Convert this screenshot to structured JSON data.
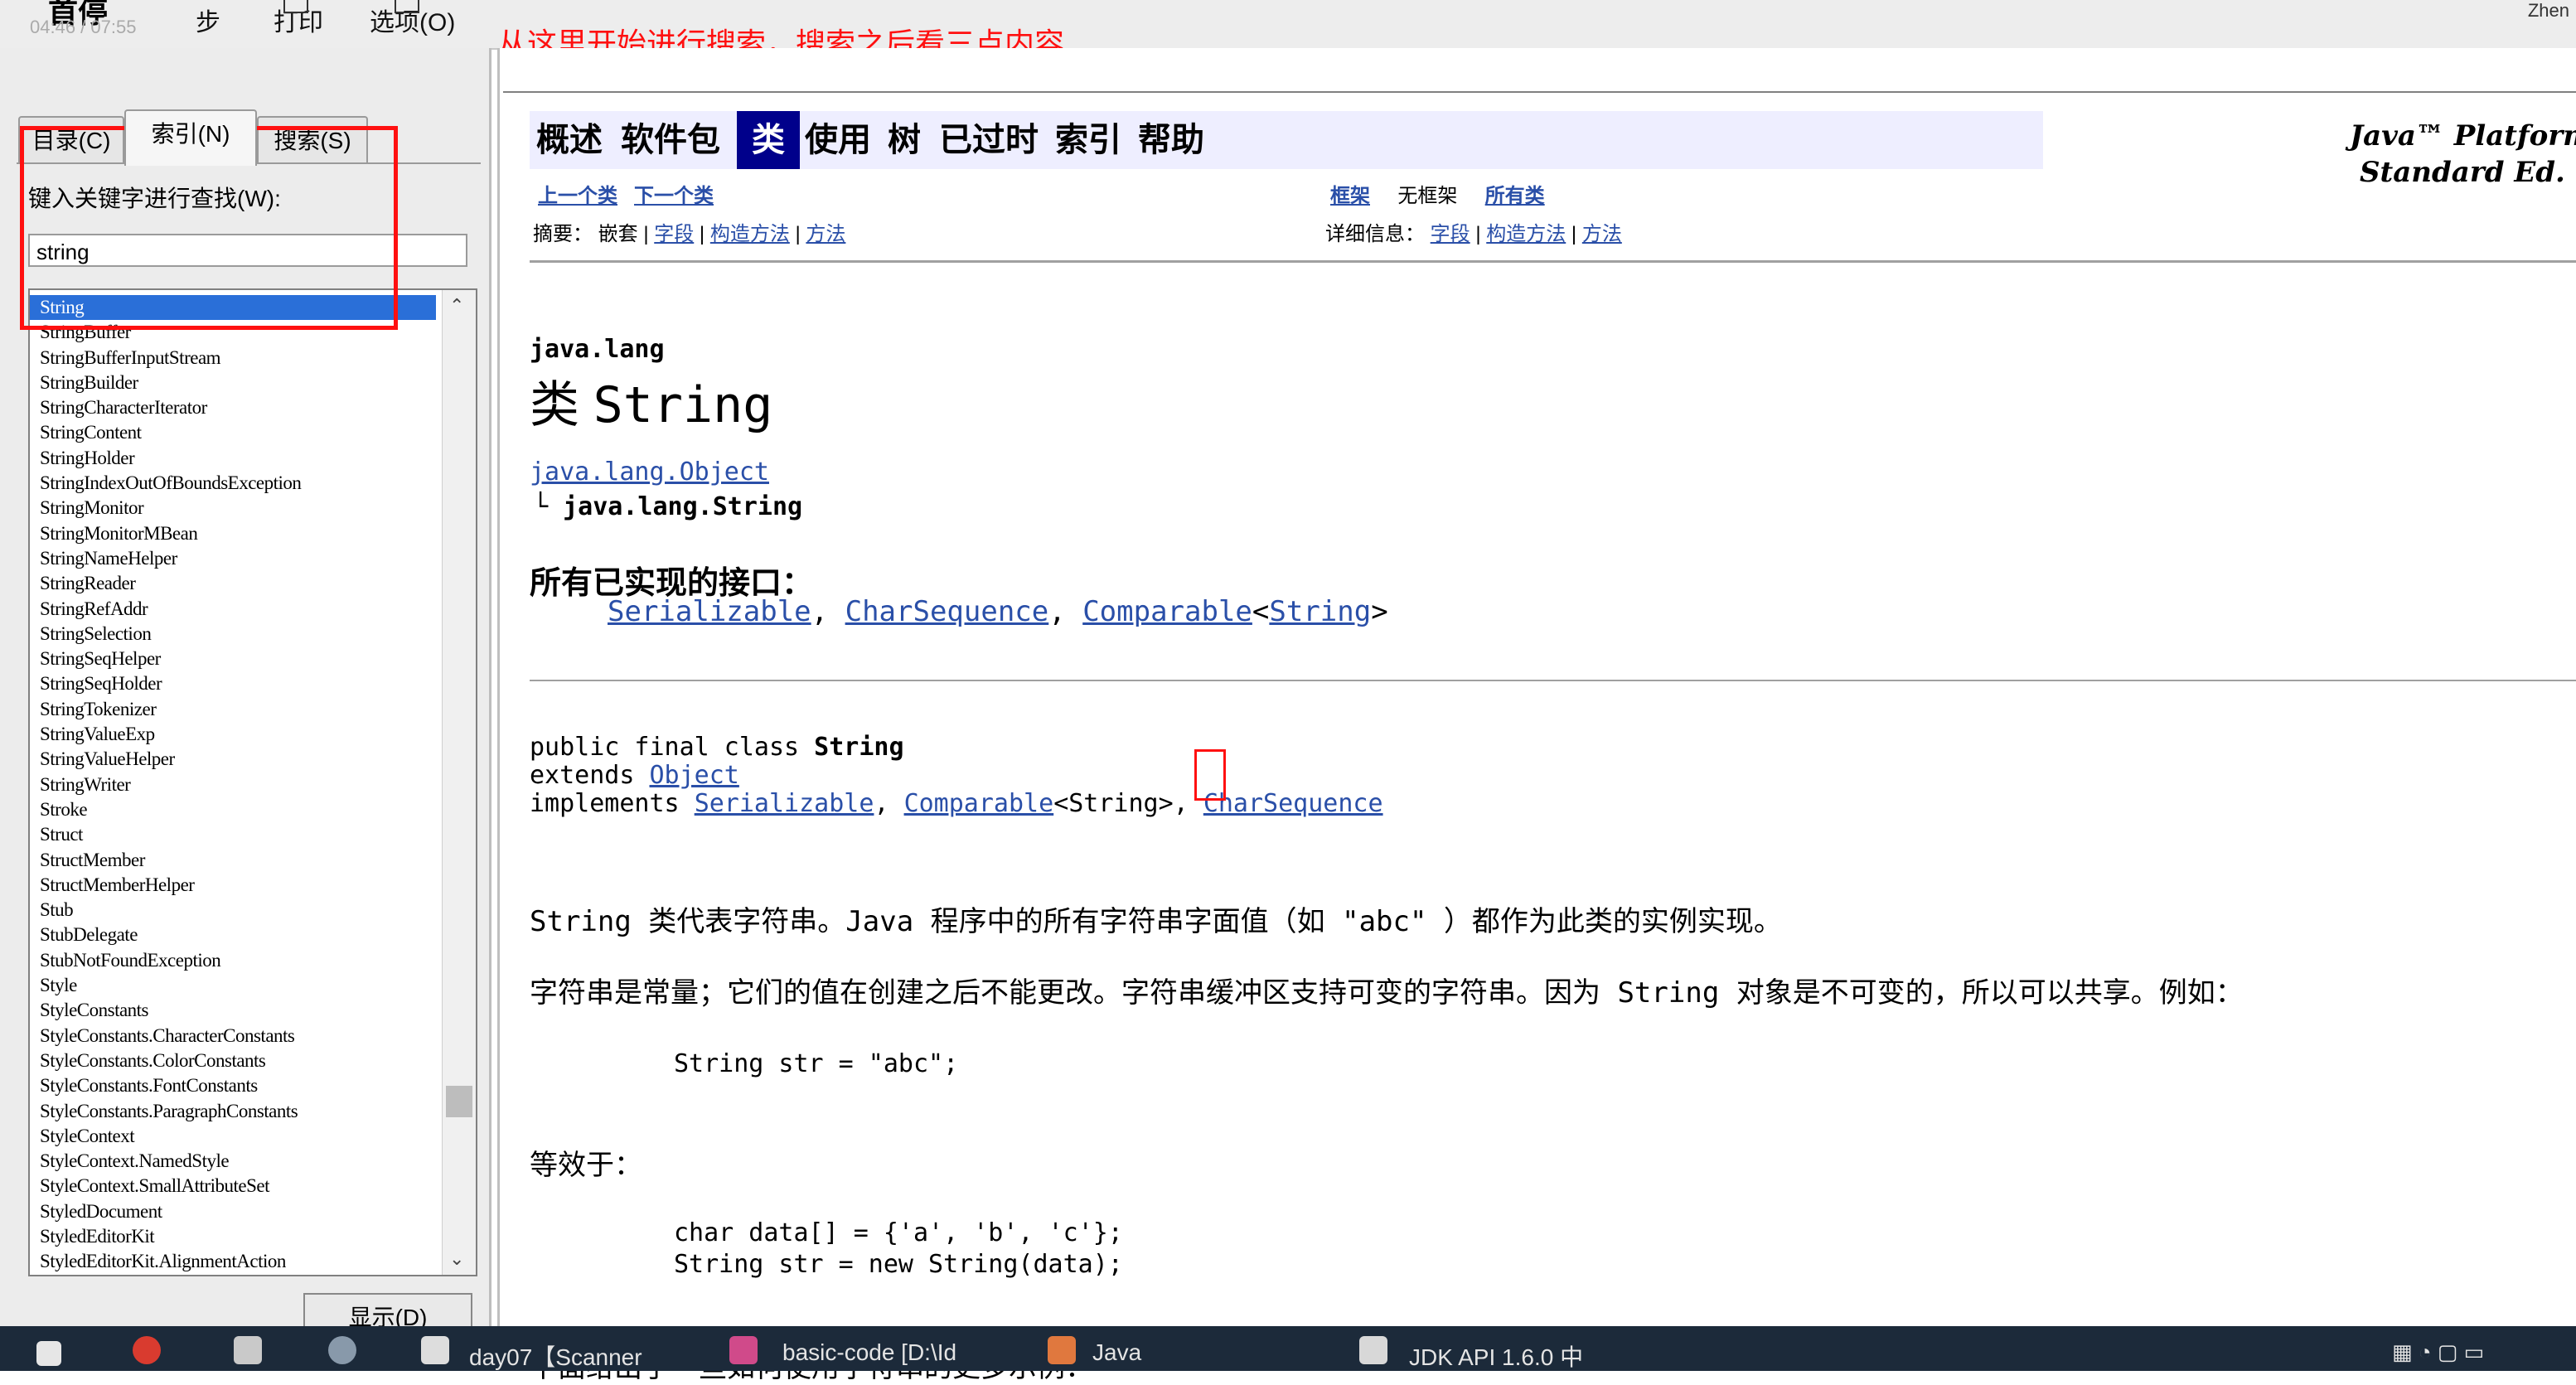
{
  "toolbar": {
    "partial_title": "首停",
    "time": "04:46 / 07:55",
    "back_fragment": "步",
    "print": "打印",
    "options": "选项(O)",
    "top_right_fragment": "Zhen"
  },
  "annotation": "从这里开始进行搜索，搜索之后看三点内容",
  "nav_pane": {
    "tabs": [
      "目录(C)",
      "索引(N)",
      "搜索(S)"
    ],
    "active_tab": 1,
    "keyword_label": "键入关键字进行查找(W):",
    "keyword_value": "string",
    "show_button": "显示(D)",
    "index_items": [
      "String",
      "StringBuffer",
      "StringBufferInputStream",
      "StringBuilder",
      "StringCharacterIterator",
      "StringContent",
      "StringHolder",
      "StringIndexOutOfBoundsException",
      "StringMonitor",
      "StringMonitorMBean",
      "StringNameHelper",
      "StringReader",
      "StringRefAddr",
      "StringSelection",
      "StringSeqHelper",
      "StringSeqHolder",
      "StringTokenizer",
      "StringValueExp",
      "StringValueHelper",
      "StringWriter",
      "Stroke",
      "Struct",
      "StructMember",
      "StructMemberHelper",
      "Stub",
      "StubDelegate",
      "StubNotFoundException",
      "Style",
      "StyleConstants",
      "StyleConstants.CharacterConstants",
      "StyleConstants.ColorConstants",
      "StyleConstants.FontConstants",
      "StyleConstants.ParagraphConstants",
      "StyleContext",
      "StyleContext.NamedStyle",
      "StyleContext.SmallAttributeSet",
      "StyledDocument",
      "StyledEditorKit",
      "StyledEditorKit.AlignmentAction"
    ],
    "selected_index": 0
  },
  "doc": {
    "navbar": [
      "概述",
      "软件包",
      "类",
      "使用",
      "树",
      "已过时",
      "索引",
      "帮助"
    ],
    "navbar_current": 2,
    "platform_line1": "Java™ Platform",
    "platform_line2": "Standard Ed.",
    "prev_class": "上一个类",
    "next_class": "下一个类",
    "frames": "框架",
    "no_frames": "无框架",
    "all_classes": "所有类",
    "summary_label": "摘要：",
    "nested": "嵌套",
    "field": "字段",
    "constructor": "构造方法",
    "method": "方法",
    "detail_label": "详细信息：",
    "sep": " | ",
    "package": "java.lang",
    "class_kw": "类",
    "class_name": "String",
    "super_link": "java.lang.Object",
    "inherit_branch": "└",
    "inherit_name": "java.lang.String",
    "interfaces_heading": "所有已实现的接口：",
    "iface_serializable": "Serializable",
    "iface_charseq": "CharSequence",
    "iface_comparable": "Comparable",
    "iface_generic_open": "<",
    "iface_generic_type": "String",
    "iface_generic_close": ">",
    "comma": ", ",
    "decl_prefix": "public final class",
    "decl_extends": "extends",
    "decl_object": "Object",
    "decl_implements": "implements",
    "decl_generic": "<String>",
    "para1": "String 类代表字符串。Java 程序中的所有字符串字面值（如 \"abc\" ）都作为此类的实例实现。",
    "para2": "字符串是常量；它们的值在创建之后不能更改。字符串缓冲区支持可变的字符串。因为 String 对象是不可变的，所以可以共享。例如：",
    "code1": "String str = \"abc\";",
    "para3": "等效于：",
    "code2a": "char data[] = {'a', 'b', 'c'};",
    "code2b": "String str = new String(data);",
    "para4": "下面给出了一些如何使用字符串的更多示例："
  },
  "taskbar": {
    "items": [
      "day07【Scanner",
      "basic-code [D:\\Id",
      "Java",
      "JDK API 1.6.0 中"
    ]
  },
  "colors": {
    "accent_red": "#ff1010",
    "link_blue": "#2a4fa8",
    "selection_blue": "#2a6fd8",
    "navbar_current": "#00008b"
  }
}
